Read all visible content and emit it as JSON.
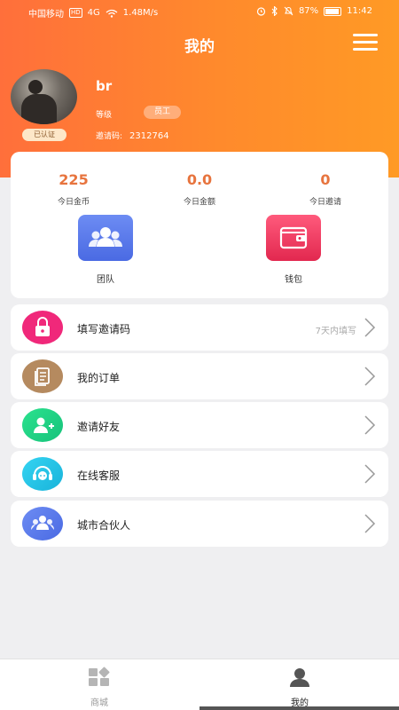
{
  "status_bar": {
    "carrier": "中国移动",
    "network": "HD",
    "signal": "4G",
    "speed": "1.48M/s",
    "battery": "87%",
    "time": "11:42"
  },
  "header": {
    "title": "我的"
  },
  "profile": {
    "name": "br",
    "verified": "已认证",
    "level_label": "等级",
    "level_value": "员工",
    "invite_label": "邀请码:",
    "invite_code": "2312764"
  },
  "stats": [
    {
      "value": "225",
      "label": "今日金币"
    },
    {
      "value": "0.0",
      "label": "今日金额"
    },
    {
      "value": "0",
      "label": "今日邀请"
    }
  ],
  "quick_actions": [
    {
      "label": "团队",
      "icon": "team-icon"
    },
    {
      "label": "钱包",
      "icon": "wallet-icon"
    }
  ],
  "menu": [
    {
      "label": "填写邀请码",
      "hint": "7天内填写",
      "icon": "lock-icon",
      "color": "#f0287a"
    },
    {
      "label": "我的订单",
      "hint": "",
      "icon": "order-icon",
      "color": "#b58a5f"
    },
    {
      "label": "邀请好友",
      "hint": "",
      "icon": "add-friend-icon",
      "color": "#22d18a"
    },
    {
      "label": "在线客服",
      "hint": "",
      "icon": "customer-service-icon",
      "color": "#22c4e8"
    },
    {
      "label": "城市合伙人",
      "hint": "",
      "icon": "partner-icon",
      "color": "#4a6ae3"
    }
  ],
  "bottom_nav": [
    {
      "label": "商城",
      "icon": "shop-icon",
      "active": false
    },
    {
      "label": "我的",
      "icon": "profile-icon",
      "active": true
    }
  ],
  "colors": {
    "accent": "#ff7f33",
    "stat_number": "#e7743e"
  }
}
